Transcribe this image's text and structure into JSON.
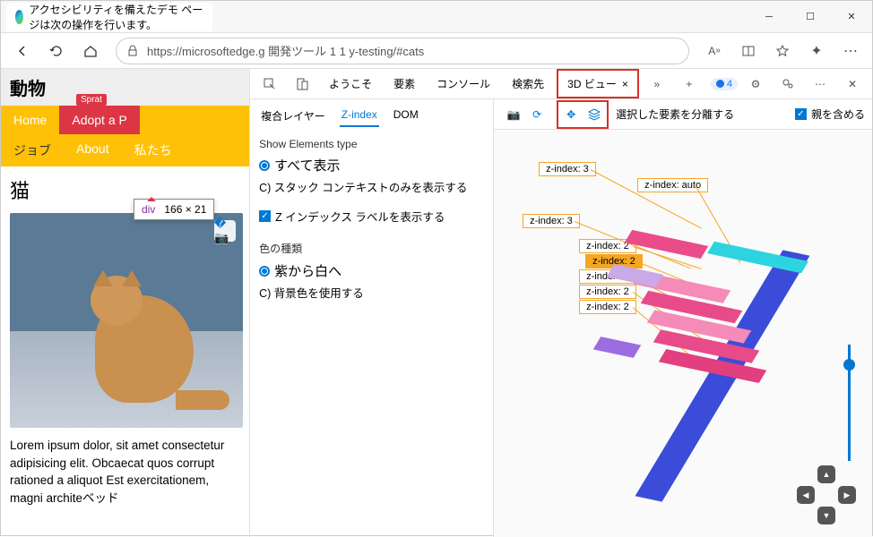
{
  "titlebar": {
    "tab_title": "アクセシビリティを備えたデモ ページは次の操作を行います。"
  },
  "toolbar": {
    "url": "https://microsoftedge.g 開発ツール 1 1 y-testing/#cats"
  },
  "page": {
    "header": "動物",
    "nav1": {
      "home": "Home",
      "adopt": "Adopt a P",
      "sprat": "Sprat"
    },
    "nav2": {
      "jobs": "ジョブ",
      "about": "About",
      "us": "私たち"
    },
    "inspect": {
      "tag": "div",
      "size": "166 × 21"
    },
    "h2": "猫",
    "paragraph": "Lorem ipsum dolor, sit amet consectetur adipisicing elit. Obcaecat quos corrupt rationed a aliquot Est exercitationem, magni architeベッド"
  },
  "devtools": {
    "tabs": {
      "welcome": "ようこそ",
      "elements": "要素",
      "console": "コンソール",
      "search": "検索先",
      "view3d": "3D ビュー"
    },
    "issues_count": "4",
    "subtabs": {
      "composite": "複合レイヤー",
      "zindex": "Z-index",
      "dom": "DOM"
    },
    "elements_type": {
      "heading": "Show Elements type",
      "all": "すべて表示",
      "stack_only": "C) スタック コンテキストのみを表示する",
      "show_label": "Z インデックス ラベルを表示する"
    },
    "color_type": {
      "heading": "色の種類",
      "purple_white": "紫から白へ",
      "background": "C) 背景色を使用する"
    },
    "canvas_toolbar": {
      "isolate": "選択した要素を分離する",
      "include_parent": "親を含める"
    },
    "zlabels": [
      "z-index: 3",
      "z-index: auto",
      "z-index: 3",
      "z-index: 2",
      "z-index: 2",
      "z-index: 2",
      "z-index: 2",
      "z-index: 2"
    ]
  }
}
